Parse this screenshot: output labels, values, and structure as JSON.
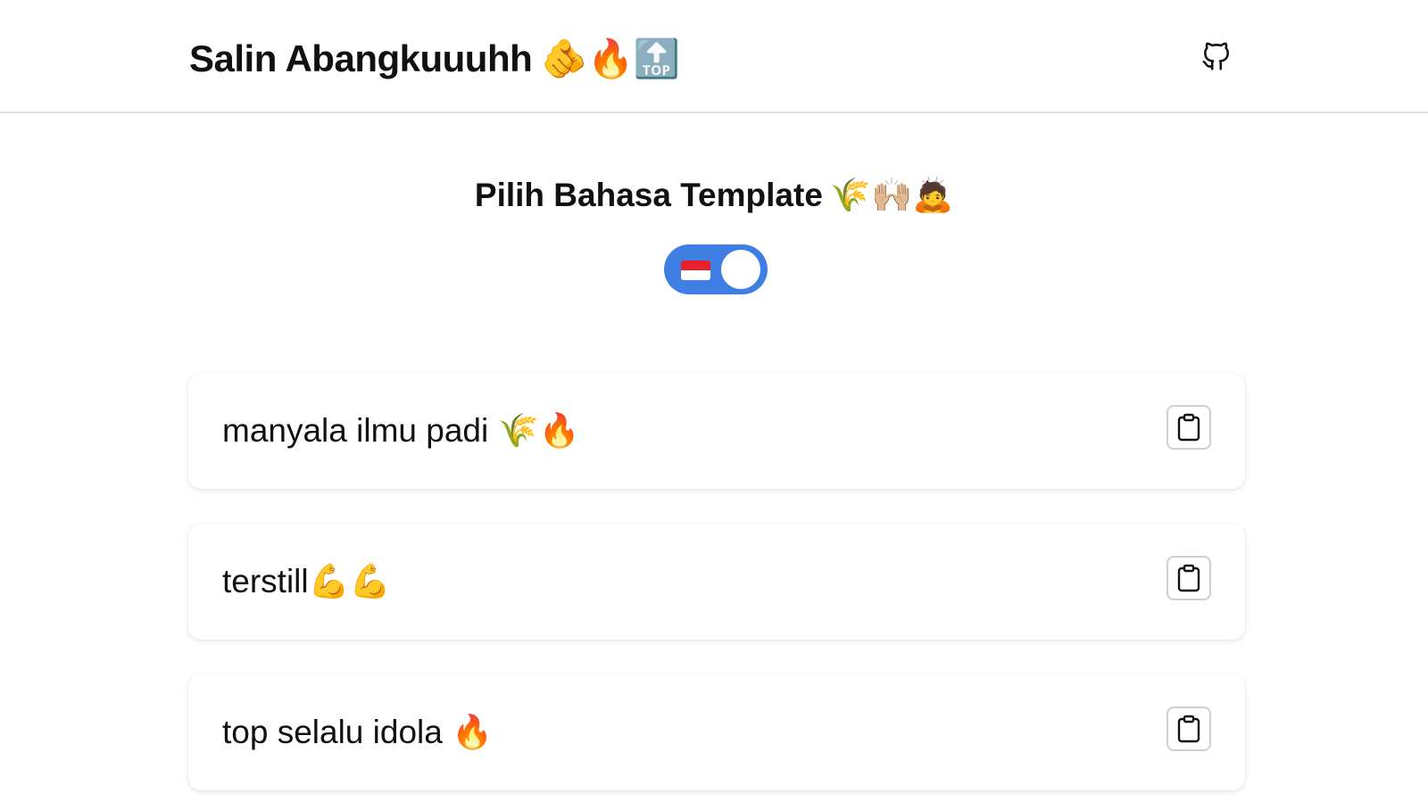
{
  "header": {
    "title": "Salin Abangkuuuhh",
    "title_emoji": "🫵🔥🔝",
    "github_icon": "github-icon"
  },
  "language_section": {
    "title": "Pilih Bahasa Template",
    "title_emoji": "🌾🙌🏼🙇",
    "toggle": {
      "selected": "Indonesian",
      "flag_icon": "indonesia-flag-icon",
      "on": true,
      "color": "#3f7fe4"
    }
  },
  "templates": [
    {
      "text": "manyala ilmu padi 🌾🔥",
      "copy_icon": "clipboard-icon"
    },
    {
      "text": "terstill💪💪",
      "copy_icon": "clipboard-icon"
    },
    {
      "text": "top selalu idola 🔥",
      "copy_icon": "clipboard-icon"
    }
  ]
}
